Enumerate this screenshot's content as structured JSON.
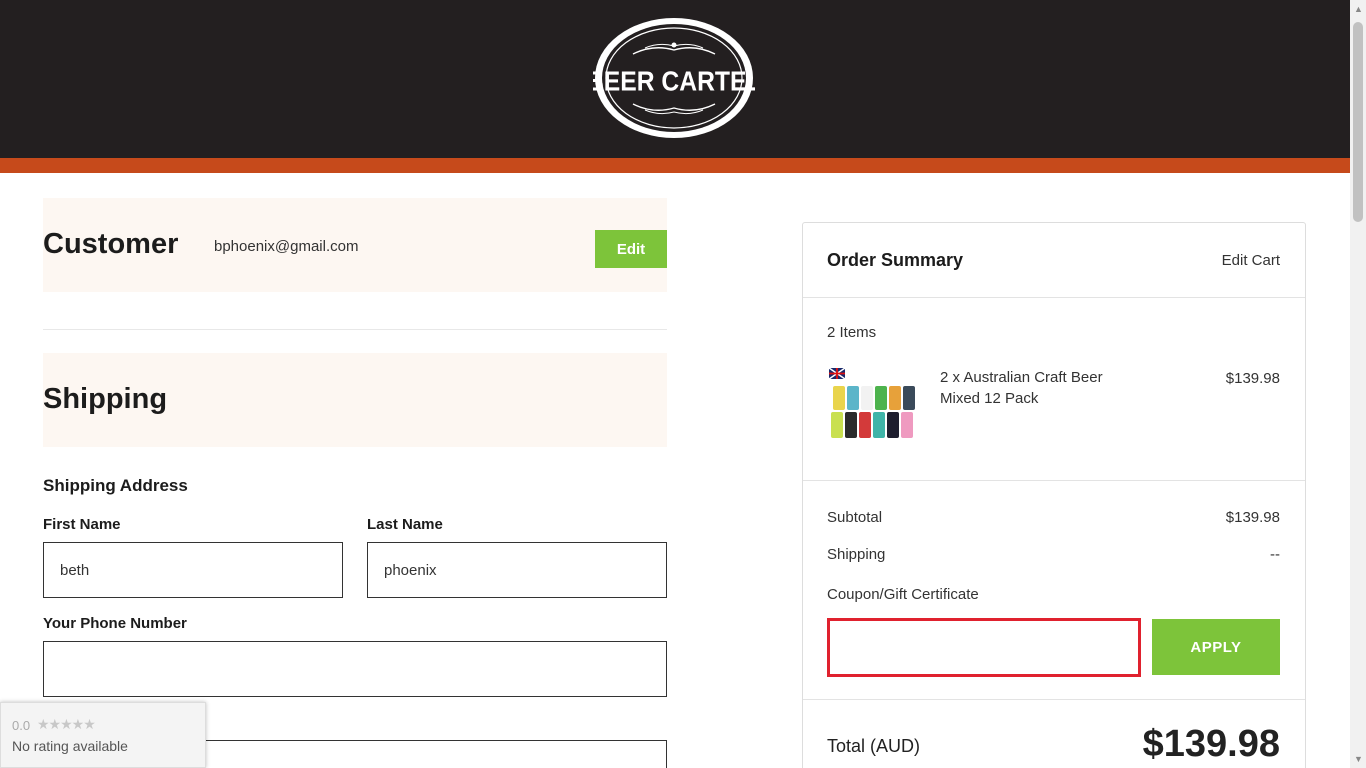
{
  "brand": {
    "name": "BEER CARTEL",
    "header_color": "#231f20",
    "stripe_color": "#c64a1b",
    "accent_color": "#7dc43a"
  },
  "customer": {
    "title": "Customer",
    "email": "bphoenix@gmail.com",
    "edit_label": "Edit"
  },
  "shipping": {
    "title": "Shipping",
    "address_label": "Shipping Address",
    "first_name_label": "First Name",
    "first_name_value": "beth",
    "last_name_label": "Last Name",
    "last_name_value": "phoenix",
    "phone_label": "Your Phone Number",
    "phone_value": ""
  },
  "rating_widget": {
    "score": "0.0",
    "stars": "★★★★★",
    "text": "No rating available"
  },
  "order_summary": {
    "title": "Order Summary",
    "edit_cart_label": "Edit Cart",
    "items_count": "2 Items",
    "items": [
      {
        "name": "2 x Australian Craft Beer Mixed 12 Pack",
        "price": "$139.98",
        "image_icon": "beer-cans-product-image"
      }
    ],
    "subtotal_label": "Subtotal",
    "subtotal_value": "$139.98",
    "shipping_label": "Shipping",
    "shipping_value": "--",
    "coupon_label": "Coupon/Gift Certificate",
    "coupon_value": "",
    "apply_label": "APPLY",
    "total_label": "Total (AUD)",
    "total_value": "$139.98"
  }
}
